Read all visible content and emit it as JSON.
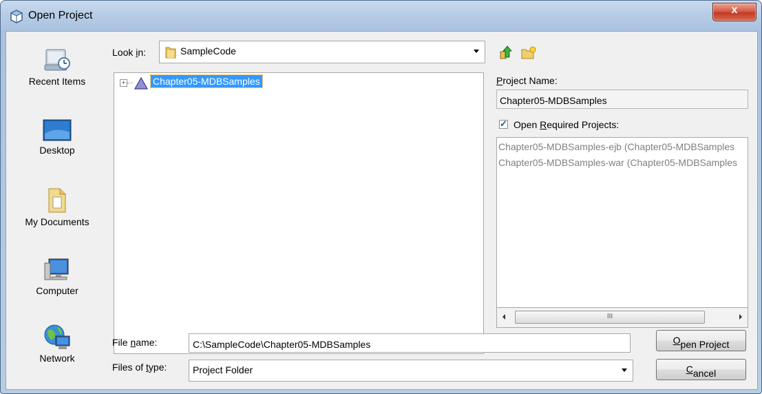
{
  "window": {
    "title": "Open Project",
    "close_glyph": "x"
  },
  "places": [
    {
      "label": "Recent Items",
      "icon": "recent-items-icon"
    },
    {
      "label": "Desktop",
      "icon": "desktop-icon"
    },
    {
      "label": "My Documents",
      "icon": "my-documents-icon"
    },
    {
      "label": "Computer",
      "icon": "computer-icon"
    },
    {
      "label": "Network",
      "icon": "network-icon"
    }
  ],
  "look_in": {
    "label_pre": "Look ",
    "label_u": "i",
    "label_post": "n:",
    "value": "SampleCode"
  },
  "tree": {
    "expander": "+",
    "selected_item": "Chapter05-MDBSamples"
  },
  "project_name": {
    "label_u": "P",
    "label_post": "roject Name:",
    "value": "Chapter05-MDBSamples"
  },
  "open_required": {
    "checked": true,
    "label_pre": "Open ",
    "label_u": "R",
    "label_post": "equired Projects:"
  },
  "required_projects": [
    "Chapter05-MDBSamples-ejb (Chapter05-MDBSamples",
    "Chapter05-MDBSamples-war (Chapter05-MDBSamples"
  ],
  "scrollbar_grip": "III",
  "file_name": {
    "label_pre": "File ",
    "label_u": "n",
    "label_post": "ame:",
    "value": "C:\\SampleCode\\Chapter05-MDBSamples"
  },
  "files_of_type": {
    "label_pre": "Files of ",
    "label_u": "t",
    "label_post": "ype:",
    "value": "Project Folder"
  },
  "buttons": {
    "open": {
      "u": "O",
      "rest": "pen Project"
    },
    "cancel": {
      "u": "C",
      "rest": "ancel"
    }
  },
  "colors": {
    "selection": "#3399ff",
    "titlebar": "#b7cde6",
    "close": "#c43a24"
  }
}
